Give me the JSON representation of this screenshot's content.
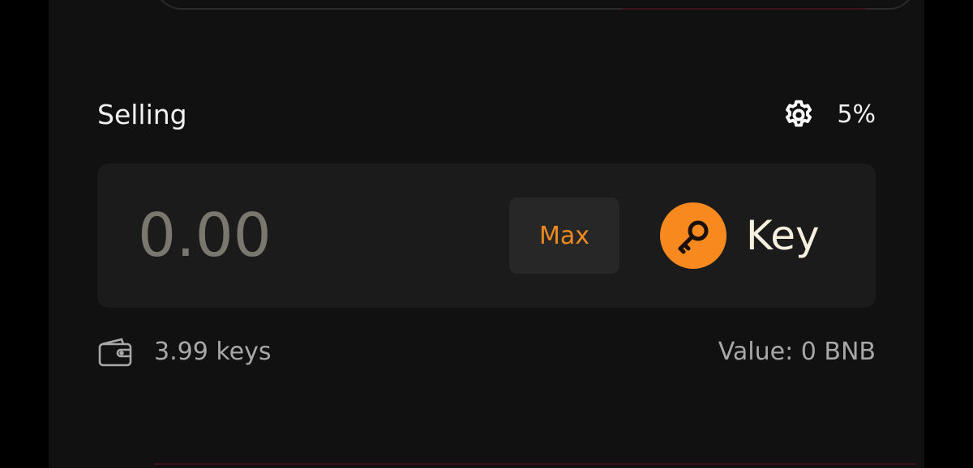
{
  "sell": {
    "label": "Selling",
    "slippage": "5%",
    "amount_placeholder": "0.00",
    "max_label": "Max",
    "token_symbol": "Key",
    "balance": "3.99 keys",
    "value": "Value: 0 BNB"
  },
  "icons": {
    "settings": "gear-icon",
    "token_logo": "key-icon",
    "balance": "wallet-icon"
  },
  "colors": {
    "background": "#111111",
    "card": "#1b1b1b",
    "accent": "#f7891e",
    "max_text": "#f08a1e",
    "token_text": "#f7f0df",
    "muted_text": "#a8a8a8"
  }
}
